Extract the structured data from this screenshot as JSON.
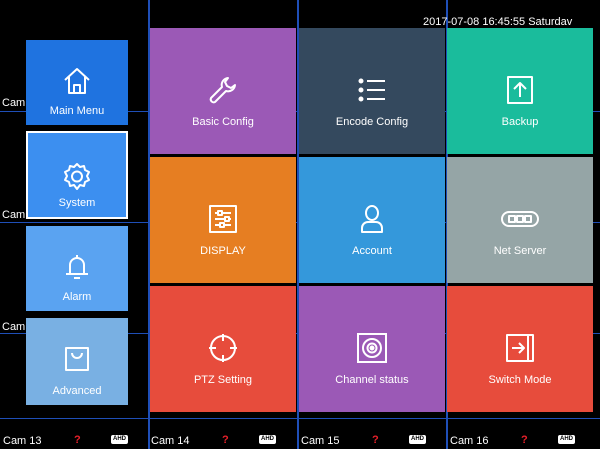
{
  "status": {
    "datetime": "2017-07-08 16:45:55  Saturdav"
  },
  "cameras": {
    "left_labels": [
      "Cam",
      "Cam",
      "Cam"
    ],
    "bottom": [
      {
        "name": "Cam 13",
        "badge": "AHD",
        "alert": "?"
      },
      {
        "name": "Cam 14",
        "badge": "AHD",
        "alert": "?"
      },
      {
        "name": "Cam 15",
        "badge": "AHD",
        "alert": "?"
      },
      {
        "name": "Cam 16",
        "badge": "AHD",
        "alert": "?"
      }
    ]
  },
  "sidebar": {
    "selected": "System",
    "items": [
      {
        "label": "Main Menu",
        "icon": "home-icon",
        "color": "#1f73e0"
      },
      {
        "label": "System",
        "icon": "gear-icon",
        "color": "#3c8ff0"
      },
      {
        "label": "Alarm",
        "icon": "bell-icon",
        "color": "#5aa3f1"
      },
      {
        "label": "Advanced",
        "icon": "shopping-bag-icon",
        "color": "#79b0e3"
      }
    ]
  },
  "tiles": [
    {
      "label": "Basic Config",
      "icon": "wrench-icon",
      "color": "#9b59b6"
    },
    {
      "label": "Encode Config",
      "icon": "list-icon",
      "color": "#34495e"
    },
    {
      "label": "Backup",
      "icon": "upload-box-icon",
      "color": "#1abc9c"
    },
    {
      "label": "DISPLAY",
      "icon": "sliders-icon",
      "color": "#e67e22"
    },
    {
      "label": "Account",
      "icon": "user-icon",
      "color": "#3498db"
    },
    {
      "label": "Net Server",
      "icon": "network-device-icon",
      "color": "#95a5a6"
    },
    {
      "label": "PTZ Setting",
      "icon": "crosshair-icon",
      "color": "#e74c3c"
    },
    {
      "label": "Channel status",
      "icon": "speaker-box-icon",
      "color": "#9b59b6"
    },
    {
      "label": "Switch Mode",
      "icon": "switch-door-icon",
      "color": "#e74c3c"
    }
  ]
}
